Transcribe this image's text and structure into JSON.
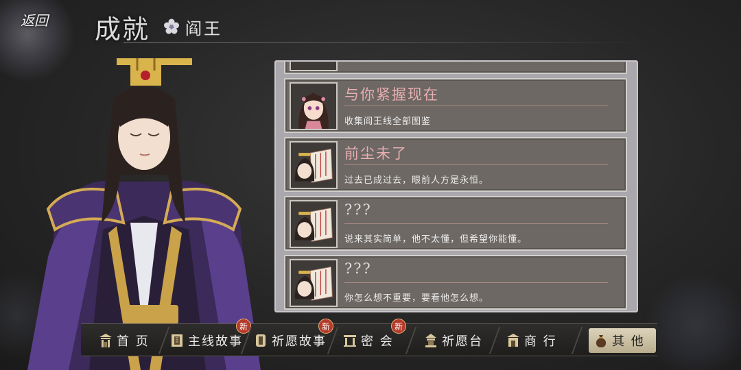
{
  "header": {
    "back_label": "返回",
    "title": "成就",
    "character": "阎王"
  },
  "achievements": [
    {
      "title": "与你紧握现在",
      "desc": "收集阎王线全部图鉴",
      "style": "pink",
      "thumb": "character-portrait"
    },
    {
      "title": "前尘未了",
      "desc": "过去已成过去，眼前人方是永恒。",
      "style": "pink",
      "thumb": "story-book"
    },
    {
      "title": "???",
      "desc": "说来其实简单，他不太懂，但希望你能懂。",
      "style": "unknown",
      "thumb": "story-book"
    },
    {
      "title": "???",
      "desc": "你怎么想不重要，要看他怎么想。",
      "style": "unknown",
      "thumb": "story-book"
    }
  ],
  "nav": {
    "items": [
      {
        "label": "首 页",
        "icon": "gate-icon",
        "badge": ""
      },
      {
        "label": "主线故事",
        "icon": "book-icon",
        "badge": "新"
      },
      {
        "label": "祈愿故事",
        "icon": "scroll-icon",
        "badge": "新"
      },
      {
        "label": "密 会",
        "icon": "pavilion-icon",
        "badge": "新"
      },
      {
        "label": "祈愿台",
        "icon": "altar-icon",
        "badge": ""
      },
      {
        "label": "商 行",
        "icon": "shop-icon",
        "badge": ""
      },
      {
        "label": "其 他",
        "icon": "pouch-icon",
        "badge": ""
      }
    ]
  },
  "colors": {
    "panel": "#aaa8ac",
    "card": "#6d6864",
    "title_pink": "#e8aeb1",
    "badge_red": "#b43a2a"
  }
}
